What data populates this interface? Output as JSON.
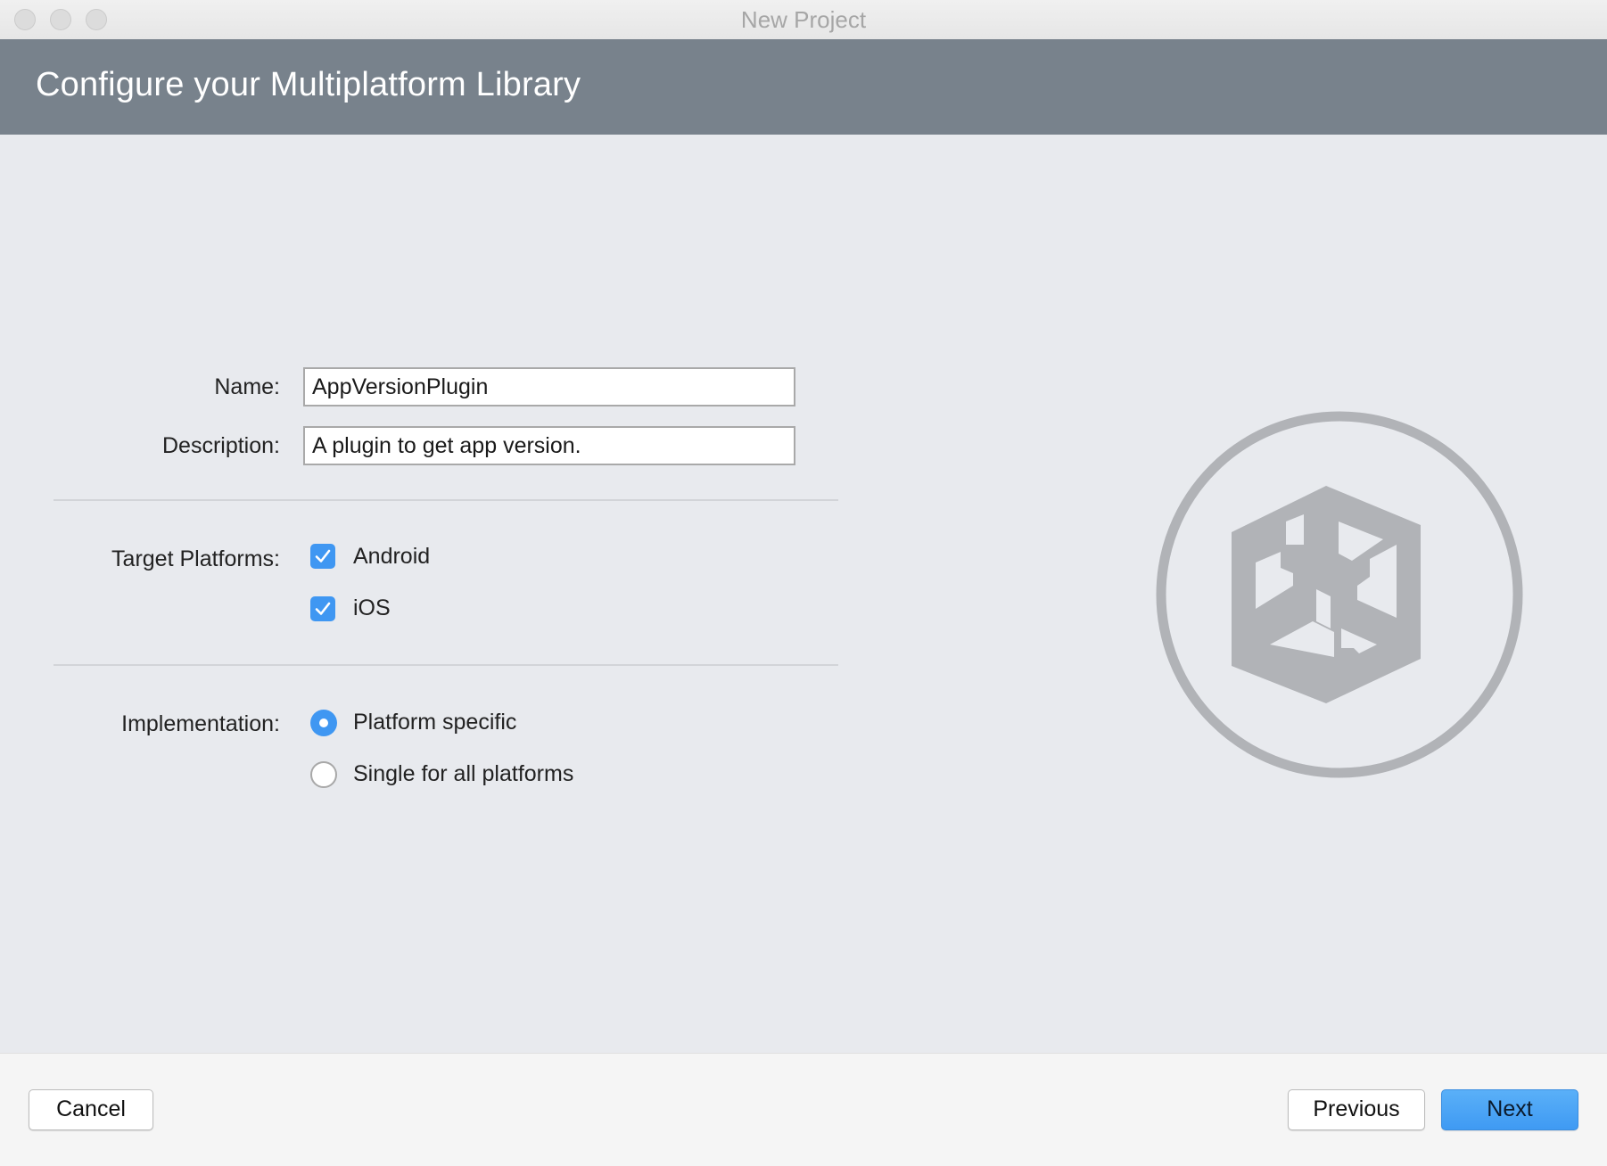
{
  "window": {
    "title": "New Project"
  },
  "header": {
    "title": "Configure your Multiplatform Library"
  },
  "form": {
    "name_label": "Name:",
    "name_value": "AppVersionPlugin",
    "description_label": "Description:",
    "description_value": "A plugin to get app version.",
    "target_platforms_label": "Target Platforms:",
    "platforms": [
      {
        "label": "Android",
        "checked": true
      },
      {
        "label": "iOS",
        "checked": true
      }
    ],
    "implementation_label": "Implementation:",
    "implementation_options": [
      {
        "label": "Platform specific",
        "selected": true
      },
      {
        "label": "Single for all platforms",
        "selected": false
      }
    ]
  },
  "illustration": {
    "icon": "multiplatform-library-cube-icon"
  },
  "footer": {
    "cancel_label": "Cancel",
    "previous_label": "Previous",
    "next_label": "Next"
  },
  "colors": {
    "header_bg": "#78828c",
    "accent": "#3f97f2",
    "content_bg": "#e8eaee"
  }
}
